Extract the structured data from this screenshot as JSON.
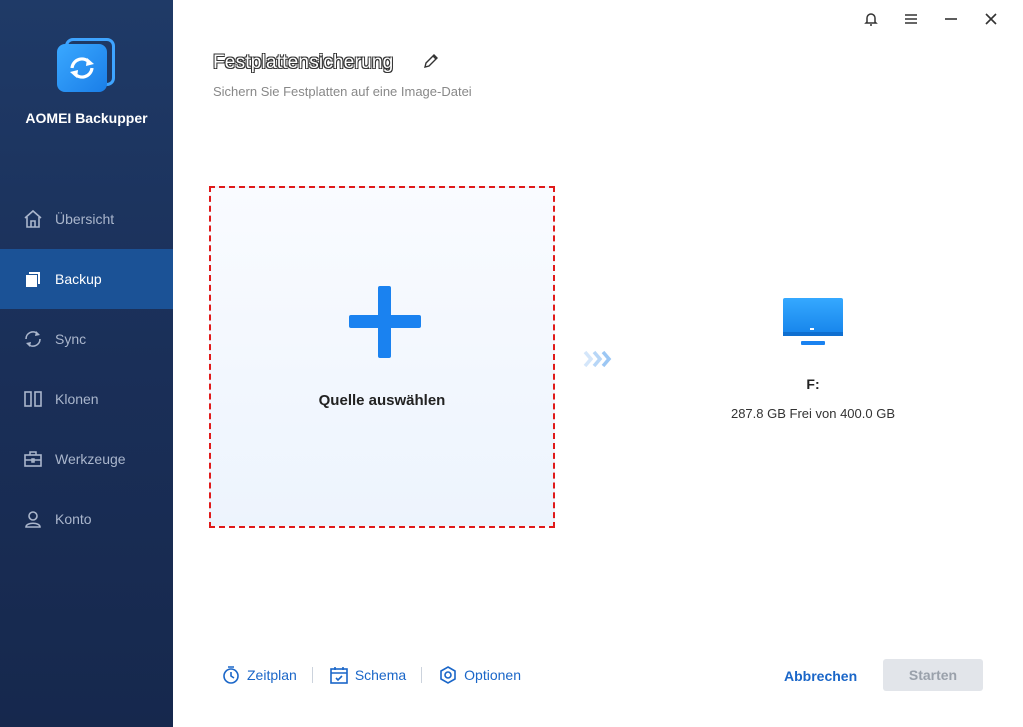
{
  "app": {
    "name": "AOMEI Backupper"
  },
  "sidebar": {
    "items": [
      {
        "label": "Übersicht",
        "icon": "home-icon",
        "active": false
      },
      {
        "label": "Backup",
        "icon": "backup-icon",
        "active": true
      },
      {
        "label": "Sync",
        "icon": "sync-icon",
        "active": false
      },
      {
        "label": "Klonen",
        "icon": "clone-icon",
        "active": false
      },
      {
        "label": "Werkzeuge",
        "icon": "toolbox-icon",
        "active": false
      },
      {
        "label": "Konto",
        "icon": "user-icon",
        "active": false
      }
    ]
  },
  "titlebar": {
    "icons": [
      "bell-icon",
      "menu-icon",
      "minimize-icon",
      "close-icon"
    ]
  },
  "header": {
    "title": "Festplattensicherung",
    "subtitle": "Sichern Sie Festplatten auf eine Image-Datei"
  },
  "source": {
    "label": "Quelle auswählen"
  },
  "destination": {
    "label": "F:",
    "info": "287.8 GB Frei von 400.0 GB"
  },
  "footer": {
    "schedule": "Zeitplan",
    "scheme": "Schema",
    "options": "Optionen",
    "cancel": "Abbrechen",
    "start": "Starten"
  },
  "colors": {
    "accent": "#1a82f0",
    "sidebar": "#1a2f58",
    "active_nav": "#1b5296",
    "dashed_border": "#e01a1a"
  }
}
